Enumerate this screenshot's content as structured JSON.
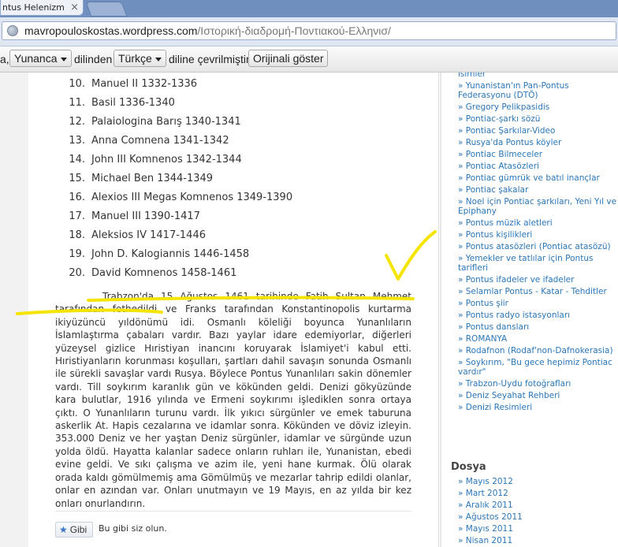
{
  "browser": {
    "tab_title": "ntus Helenizm \", Tü",
    "tab_close": "×",
    "url_host": "mavropouloskostas.wordpress.com",
    "url_path": "/Ιστορική-διαδρομή-Ποντιακού-Ελληνισ/"
  },
  "translate_bar": {
    "leading": "a,",
    "source_language": "Yunanca",
    "from_text": "dilinden",
    "target_language": "Türkçe",
    "to_text": "diline çevrilmiştir",
    "show_original": "Orijinali göster"
  },
  "post": {
    "emperors": [
      {
        "num": "10.",
        "text": "Manuel II 1332-1336"
      },
      {
        "num": "11.",
        "text": "Basil 1336-1340"
      },
      {
        "num": "12.",
        "text": "Palaiologina Barış 1340-1341"
      },
      {
        "num": "13.",
        "text": "Anna Comnena 1341-1342"
      },
      {
        "num": "14.",
        "text": "John III Komnenos 1342-1344"
      },
      {
        "num": "15.",
        "text": "Michael Ben 1344-1349"
      },
      {
        "num": "16.",
        "text": "Alexios III Megas Komnenos 1349-1390"
      },
      {
        "num": "17.",
        "text": "Manuel III 1390-1417"
      },
      {
        "num": "18.",
        "text": "Aleksios IV 1417-1446"
      },
      {
        "num": "19.",
        "text": "John D. Kalogiannis 1446-1458"
      },
      {
        "num": "20.",
        "text": "David Komnenos 1458-1461"
      }
    ],
    "paragraph": "Trabzon'da 15 Ağustos 1461 tarihinde Fatih Sultan Mehmet tarafından fethedildi ve Franks tarafından Konstantinopolis kurtarma ikiyüzüncü yıldönümü idi. Osmanlı köleliği boyunca Yunanlıların İslamlaştırma çabaları vardır. Bazı yaylar idare edemiyorlar, diğerleri yüzeysel gizlice Hıristiyan inancını koruyarak İslamiyet'i kabul etti. Hıristiyanların korunması koşulları, şartları dahil savaşın sonunda Osmanlı ile sürekli savaşlar vardı Rusya. Böylece Pontus Yunanlıları sakin dönemler vardı. Till soykırım karanlık gün ve kökünden geldi. Denizi gökyüzünde kara bulutlar, 1916 yılında ve Ermeni soykırımı işlediklen sonra ortaya çıktı. O Yunanlıların turunu vardı. İlk yıkıcı sürgünler ve emek taburuna askerlik At. Hapis cezalarına ve idamlar sonra. Kökünden ve döviz izleyin. 353.000 Deniz ve her yaştan Deniz sürgünler, idamlar ve sürgünde uzun yolda öldü. Hayatta kalanlar sadece onların ruhları ile, Yunanistan, ebedi evine geldi. Ve sıkı çalışma ve azim ile, yeni hane kurmak. Ölü olarak orada kaldı gömülmemiş ama Gömülmüş ve mezarlar tahrip edildi olanlar, onlar en azından var. Onları unutmayın ve 19 Mayıs, en az yılda bir kez onları onurlandırın.",
    "like_label": "Gibi",
    "like_text": "Bu gibi siz olun."
  },
  "sidebar": {
    "links": [
      "isimler",
      "» Yunanistan'ın Pan-Pontus Federasyonu (DTÖ)",
      "» Gregory Pelikpasidis",
      "» Pontiac-şarkı sözü",
      "» Pontiac Şarkılar-Video",
      "» Rusya'da Pontus köyler",
      "» Pontiac Bilmeceler",
      "» Pontiac Atasözleri",
      "» Pontiac gümrük ve batıl inançlar",
      "» Pontiac şakalar",
      "» Noel için Pontiac şarkıları, Yeni Yıl ve Epiphany",
      "» Pontus müzik aletleri",
      "» Pontus kişilikleri",
      "» Pontus atasözleri (Pontiac atasözü)",
      "» Yemekler ve tatlılar için Pontus tarifleri",
      "» Pontus ifadeler ve ifadeler",
      "» Selamlar Pontus - Katar - Tehditler",
      "» Pontus şiir",
      "» Pontus radyo istasyonları",
      "» Pontus dansları",
      "» ROMANYA",
      "» Rodafnon (Rodaf'non-Dafnokerasia)",
      "» Soykırım, \"Bu gece hepimiz Pontiac vardır\"",
      "» Trabzon-Uydu fotoğrafları",
      "» Deniz Seyahat Rehberi",
      "» Denizi Resimleri"
    ],
    "archive_heading": "Dosya",
    "archive": [
      "» Mayıs 2012",
      "» Mart 2012",
      "» Aralık 2011",
      "» Ağustos 2011",
      "» Mayıs 2011",
      "» Nisan 2011"
    ]
  },
  "colors": {
    "link": "#2a76b8",
    "annotation": "#f5e400"
  }
}
